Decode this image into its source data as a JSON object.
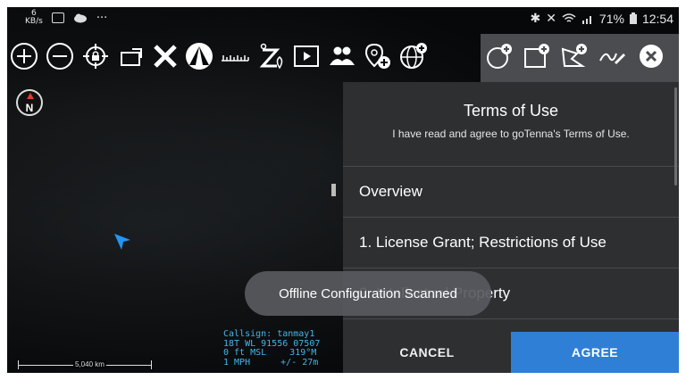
{
  "status_bar": {
    "net_speed": "6",
    "net_unit": "KB/s",
    "overflow": "···",
    "battery": "71%",
    "time": "12:54",
    "icons": [
      "gallery-icon",
      "cloud-icon",
      "bluetooth-icon",
      "mute-icon",
      "wifi-icon",
      "signal-icon",
      "battery-icon"
    ]
  },
  "toolbar": {
    "tools": [
      "zoom-in-icon",
      "zoom-out-icon",
      "lock-location-icon",
      "rotate-icon",
      "close-x-icon",
      "tent-icon",
      "ruler-icon",
      "z-marker-icon",
      "play-icon",
      "group-icon",
      "add-point-icon",
      "globe-add-icon"
    ],
    "drawing_tools": [
      "add-circle-icon",
      "add-rectangle-icon",
      "add-polygon-icon",
      "freehand-icon",
      "close-circle-icon"
    ]
  },
  "compass": {
    "label": "N"
  },
  "terms_panel": {
    "title": "Terms of Use",
    "subtitle": "I have read and agree to goTenna's Terms of Use.",
    "sections": [
      "Overview",
      "1. License Grant; Restrictions of Use",
      "2. Intellectual Property"
    ]
  },
  "buttons": {
    "cancel": "CANCEL",
    "agree": "AGREE"
  },
  "toast": {
    "message": "Offline Configuration Scanned"
  },
  "info": {
    "callsign": "Callsign: tanmay1",
    "grid": "18T WL 91556 07507",
    "elevation": "0 ft MSL",
    "heading": "319°M",
    "speed": "1 MPH",
    "accuracy": "+/- 27m"
  },
  "scale": {
    "label": "5,040 km"
  },
  "colors": {
    "accent": "#2f7fd6",
    "panel": "#2e2f31",
    "info_text": "#44b6e8",
    "location_arrow": "#2196f3",
    "compass_needle": "#e53935"
  }
}
